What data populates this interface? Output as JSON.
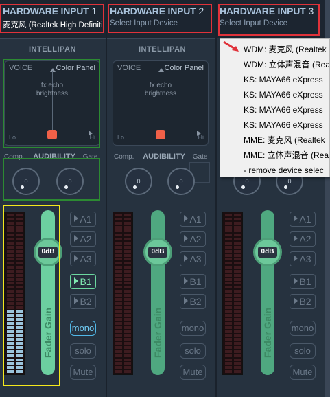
{
  "strips": [
    {
      "hw_title": "HARDWARE INPUT",
      "hw_num": "1",
      "device": "麦克风 (Realtek High Definitio",
      "intellipan": "INTELLIPAN",
      "panel": {
        "voice": "VOICE",
        "color": "Color Panel",
        "fx": "fx echo",
        "brightness": "brightness",
        "lo": "Lo",
        "hi": "Hi"
      },
      "comp": "Comp.",
      "audibility": "AUDIBILITY",
      "gate": "Gate",
      "dial_left": "0",
      "dial_right": "0",
      "fader_db": "0dB",
      "fader_label": "Fader Gain",
      "buses": [
        "A1",
        "A2",
        "A3",
        "B1",
        "B2"
      ],
      "bus_on": [
        false,
        false,
        false,
        true,
        false
      ],
      "mono": "mono",
      "solo": "solo",
      "mute": "Mute",
      "mono_on": true,
      "meter_level": 0.4
    },
    {
      "hw_title": "HARDWARE INPUT",
      "hw_num": "2",
      "device": "Select Input Device",
      "intellipan": "INTELLIPAN",
      "panel": {
        "voice": "VOICE",
        "color": "Color Panel",
        "fx": "fx echo",
        "brightness": "brightness",
        "lo": "Lo",
        "hi": "Hi"
      },
      "comp": "Comp.",
      "audibility": "AUDIBILITY",
      "gate": "Gate",
      "dial_left": "0",
      "dial_right": "0",
      "fader_db": "0dB",
      "fader_label": "Fader Gain",
      "buses": [
        "A1",
        "A2",
        "A3",
        "B1",
        "B2"
      ],
      "bus_on": [
        false,
        false,
        false,
        false,
        false
      ],
      "mono": "mono",
      "solo": "solo",
      "mute": "Mute",
      "mono_on": false,
      "meter_level": 0
    },
    {
      "hw_title": "HARDWARE INPUT",
      "hw_num": "3",
      "device": "Select Input Device",
      "dial_left": "0",
      "dial_right": "0",
      "fader_db": "0dB",
      "fader_label": "Fader Gain",
      "buses": [
        "A1",
        "A2",
        "A3",
        "B1",
        "B2"
      ],
      "bus_on": [
        false,
        false,
        false,
        false,
        false
      ],
      "mono": "mono",
      "solo": "solo",
      "mute": "Mute",
      "mono_on": false,
      "meter_level": 0
    }
  ],
  "menu": {
    "items": [
      "WDM: 麦克风 (Realtek",
      "WDM: 立体声混音 (Rea",
      "KS: MAYA66 eXpress ",
      "KS: MAYA66 eXpress ",
      "KS: MAYA66 eXpress ",
      "KS: MAYA66 eXpress ",
      "MME: 麦克风 (Realtek",
      "MME: 立体声混音 (Rea",
      "- remove device selec"
    ]
  },
  "colors": {
    "background": "#232e3c",
    "fader": "#6ccfa0",
    "active_bus": "#7ee8b0",
    "mono_active": "#70ccf4",
    "highlight_red": "#e0323a",
    "highlight_green": "#2c8a32",
    "highlight_yellow": "#f4e81c"
  },
  "icons": {
    "menu_pointer": "red-arrow-icon",
    "bus_marker": "triangle-right-icon"
  }
}
